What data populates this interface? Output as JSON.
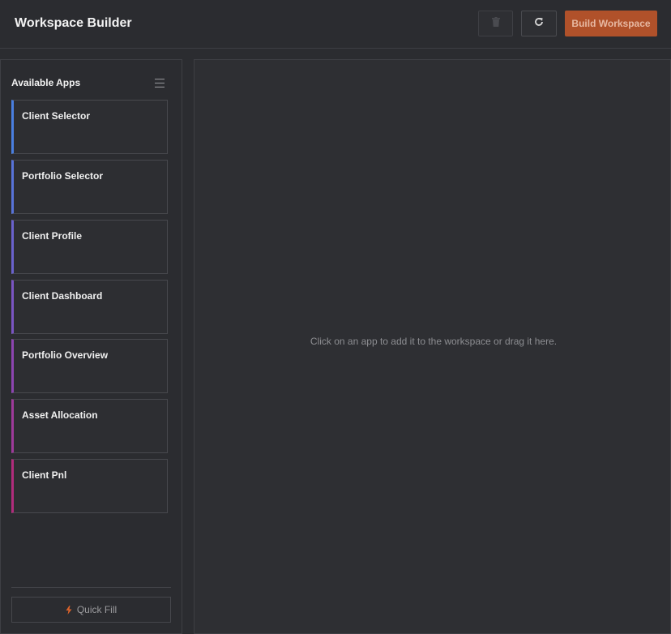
{
  "header": {
    "title": "Workspace Builder",
    "build_label": "Build Workspace"
  },
  "sidebar": {
    "title": "Available Apps",
    "apps": [
      {
        "label": "Client Selector",
        "accent": "#4a7fe0"
      },
      {
        "label": "Portfolio Selector",
        "accent": "#5873d8"
      },
      {
        "label": "Client Profile",
        "accent": "#6a62cc"
      },
      {
        "label": "Client Dashboard",
        "accent": "#7a55c2"
      },
      {
        "label": "Portfolio Overview",
        "accent": "#8c45b0"
      },
      {
        "label": "Asset Allocation",
        "accent": "#9e3a9a"
      },
      {
        "label": "Client Pnl",
        "accent": "#b02c7c"
      }
    ],
    "quick_fill_label": "Quick Fill"
  },
  "canvas": {
    "empty_message": "Click on an app to add it to the workspace or drag it here."
  },
  "colors": {
    "brand_button": "#b0512a",
    "quick_fill_icon": "#d9622b"
  }
}
